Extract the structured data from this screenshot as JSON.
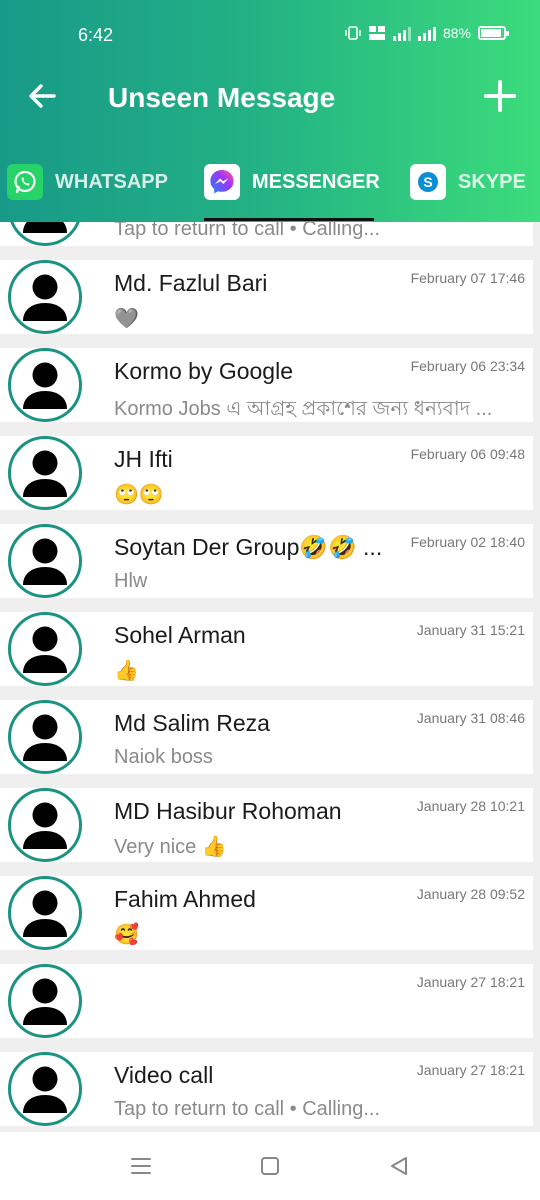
{
  "status_bar": {
    "time": "6:42",
    "battery": "88%"
  },
  "header": {
    "title": "Unseen Message"
  },
  "tabs": [
    {
      "label": "WHATSAPP",
      "icon": "whatsapp-icon",
      "color": "#25d366"
    },
    {
      "label": "MESSENGER",
      "icon": "messenger-icon",
      "color": "#7b4cf5",
      "active": true
    },
    {
      "label": "SKYPE",
      "icon": "skype-icon",
      "color": "#0a8fd6"
    }
  ],
  "messages": [
    {
      "name": "",
      "preview": "Tap to return to call • Calling...",
      "time": ""
    },
    {
      "name": "Md. Fazlul Bari",
      "preview": "🩶",
      "time": "February 07 17:46"
    },
    {
      "name": "Kormo by Google",
      "preview": "Kormo Jobs এ আগ্রহ প্রকাশের জন্য ধন্যবাদ ...",
      "time": "February 06 23:34"
    },
    {
      "name": "JH Ifti",
      "preview": "🙄🙄",
      "time": "February 06 09:48"
    },
    {
      "name": "Soytan Der Group🤣🤣 ...",
      "preview": "Hlw",
      "time": "February 02 18:40"
    },
    {
      "name": "Sohel Arman",
      "preview": "👍",
      "time": "January 31 15:21"
    },
    {
      "name": "Md Salim Reza",
      "preview": "Naiok boss",
      "time": "January 31 08:46"
    },
    {
      "name": "MD Hasibur Rohoman",
      "preview": "Very nice 👍",
      "time": "January 28 10:21"
    },
    {
      "name": "Fahim Ahmed",
      "preview": "🥰",
      "time": "January 28 09:52"
    },
    {
      "name": "",
      "preview": "",
      "time": "January 27 18:21"
    },
    {
      "name": "Video call",
      "preview": "Tap to return to call • Calling...",
      "time": "January 27 18:21"
    }
  ],
  "colors": {
    "header_start": "#189a88",
    "header_end": "#3cdc7c",
    "avatar_ring": "#1a9480"
  }
}
